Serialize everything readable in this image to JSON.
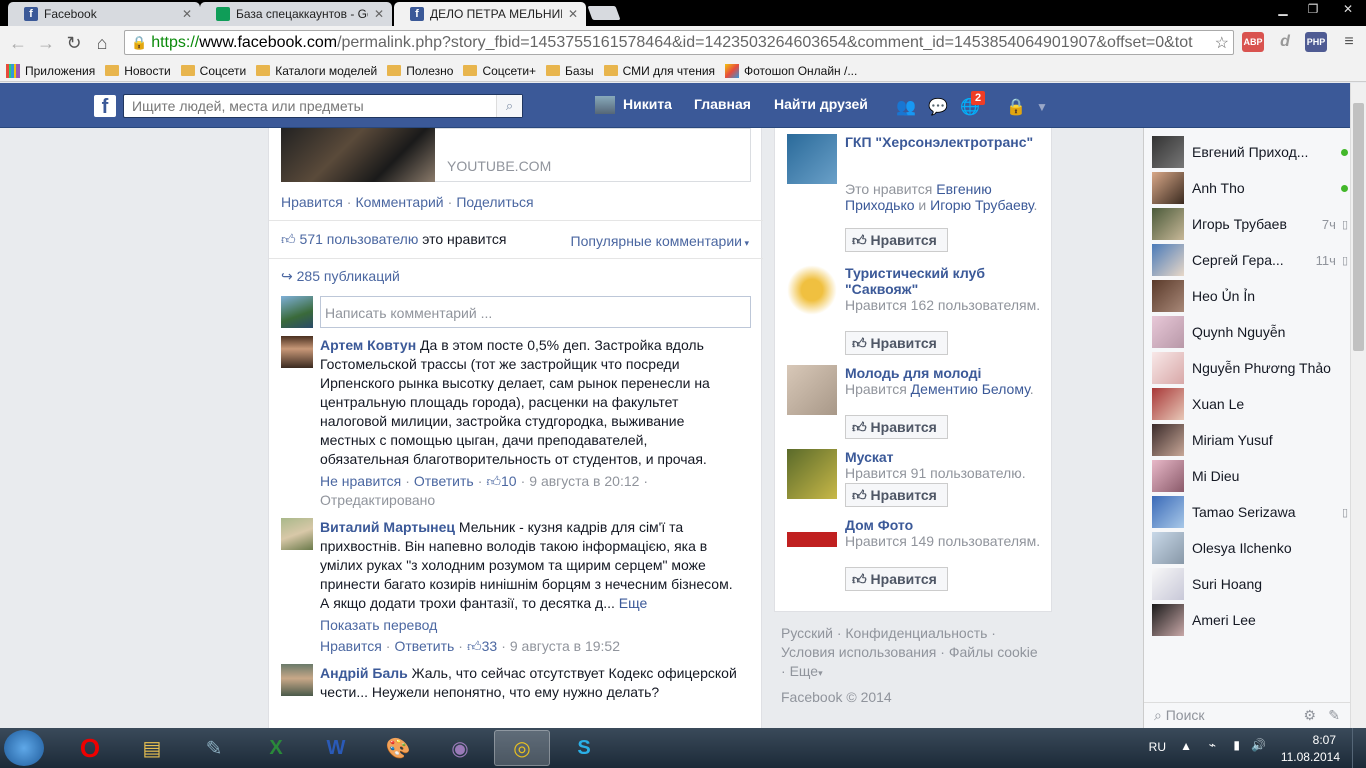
{
  "browser": {
    "tabs": [
      {
        "title": "Facebook",
        "icon": "facebook-icon"
      },
      {
        "title": "База спецаккаунтов - Go",
        "icon": "sheets-icon"
      },
      {
        "title": "ДЕЛО ПЕТРА МЕЛЬНИКА",
        "icon": "facebook-icon",
        "active": true
      }
    ],
    "url_scheme": "https://",
    "url_host": "www.facebook.com",
    "url_rest": "/permalink.php?story_fbid=1453755161578464&id=1423503264603654&comment_id=1453854064901907&offset=0&tot",
    "extensions": [
      "ABP",
      "d",
      "PHP"
    ],
    "bookmarks": [
      "Приложения",
      "Новости",
      "Соцсети",
      "Каталоги моделей",
      "Полезно",
      "Соцсети+",
      "Базы",
      "СМИ для чтения",
      "Фотошоп Онлайн /..."
    ]
  },
  "fbbar": {
    "search_placeholder": "Ищите людей, места или предметы",
    "user_name": "Никита",
    "home": "Главная",
    "find_friends": "Найти друзей",
    "notif_count": "2"
  },
  "post": {
    "link_source": "YOUTUBE.COM",
    "actions": [
      "Нравится",
      "Комментарий",
      "Поделиться"
    ],
    "likes_count": "571 пользователю",
    "likes_suffix": "это нравится",
    "sort_label": "Популярные комментарии",
    "shares": "285 публикаций",
    "write_placeholder": "Написать комментарий ...",
    "comments": [
      {
        "author": "Артем Ковтун",
        "text": "Да в этом посте 0,5% деп. Застройка вдоль Гостомельской трассы (тот же застройщик что посреди Ирпенского рынка высотку делает, сам рынок перенесли на центральную площадь города), расценки на факультет налоговой милиции, застройка студгородка, выживание местных с помощью цыган, дачи преподавателей, обязательная благотворительность от студентов, и прочая.",
        "like_action": "Не нравится",
        "reply": "Ответить",
        "likes": "10",
        "time": "9 августа в 20:12",
        "edited": "Отредактировано"
      },
      {
        "author": "Виталий Мартынец",
        "text": "Мельник - кузня кадрів для сім'ї та прихвостнів. Він напевно володів такою інформацією, яка в умілих руках \"з холодним розумом та щирим серцем\" може принести багато козирів нинішнім борцям з нечесним бізнесом. А якщо додати трохи фантазії, то десятка д...",
        "more": "Еще",
        "translate": "Показать перевод",
        "like_action": "Нравится",
        "reply": "Ответить",
        "likes": "33",
        "time": "9 августа в 19:52"
      },
      {
        "author": "Андрій Баль",
        "text": "Жаль, что сейчас отсутствует Кодекс офицерской чести... Неужели непонятно, что ему нужно делать?"
      }
    ]
  },
  "pages": [
    {
      "name": "ГКП \"Херсонэлектротранс\"",
      "sub_prefix": "Это нравится",
      "sub_link1": "Евгению Приходько",
      "sub_and": "и",
      "sub_link2": "Игорю Трубаеву",
      "sub_end": ".",
      "button": "Нравится"
    },
    {
      "name": "Туристический клуб \"Саквояж\"",
      "sub": "Нравится 162 пользователям.",
      "button": "Нравится"
    },
    {
      "name": "Молодь для молоді",
      "sub_prefix": "Нравится",
      "sub_link1": "Дементию Белому",
      "sub_end": ".",
      "button": "Нравится"
    },
    {
      "name": "Мускат",
      "sub": "Нравится 91 пользователю.",
      "button": "Нравится"
    },
    {
      "name": "Дом Фото",
      "sub": "Нравится 149 пользователям.",
      "button": "Нравится"
    }
  ],
  "footer": {
    "links": [
      "Русский",
      "Конфиденциальность",
      "Условия использования",
      "Файлы cookie",
      "Еще"
    ],
    "copyright": "Facebook © 2014"
  },
  "chat": {
    "friends": [
      {
        "name": "Евгений Приход...",
        "status": "online"
      },
      {
        "name": "Anh Tho",
        "status": "online"
      },
      {
        "name": "Игорь Трубаев",
        "time": "7ч",
        "status": "mobile"
      },
      {
        "name": "Сергей Гера...",
        "time": "11ч",
        "status": "mobile"
      },
      {
        "name": "Heo Ủn Ỉn"
      },
      {
        "name": "Quynh Nguyễn"
      },
      {
        "name": "Nguyễn Phương Thảo"
      },
      {
        "name": "Xuan Le"
      },
      {
        "name": "Miriam Yusuf"
      },
      {
        "name": "Mi Dieu"
      },
      {
        "name": "Tamao Serizawa",
        "status": "mobile"
      },
      {
        "name": "Olesya Ilchenko"
      },
      {
        "name": "Suri Hoang"
      },
      {
        "name": "Ameri Lee"
      }
    ],
    "search_placeholder": "Поиск"
  },
  "taskbar": {
    "lang": "RU",
    "time": "8:07",
    "date": "11.08.2014"
  }
}
